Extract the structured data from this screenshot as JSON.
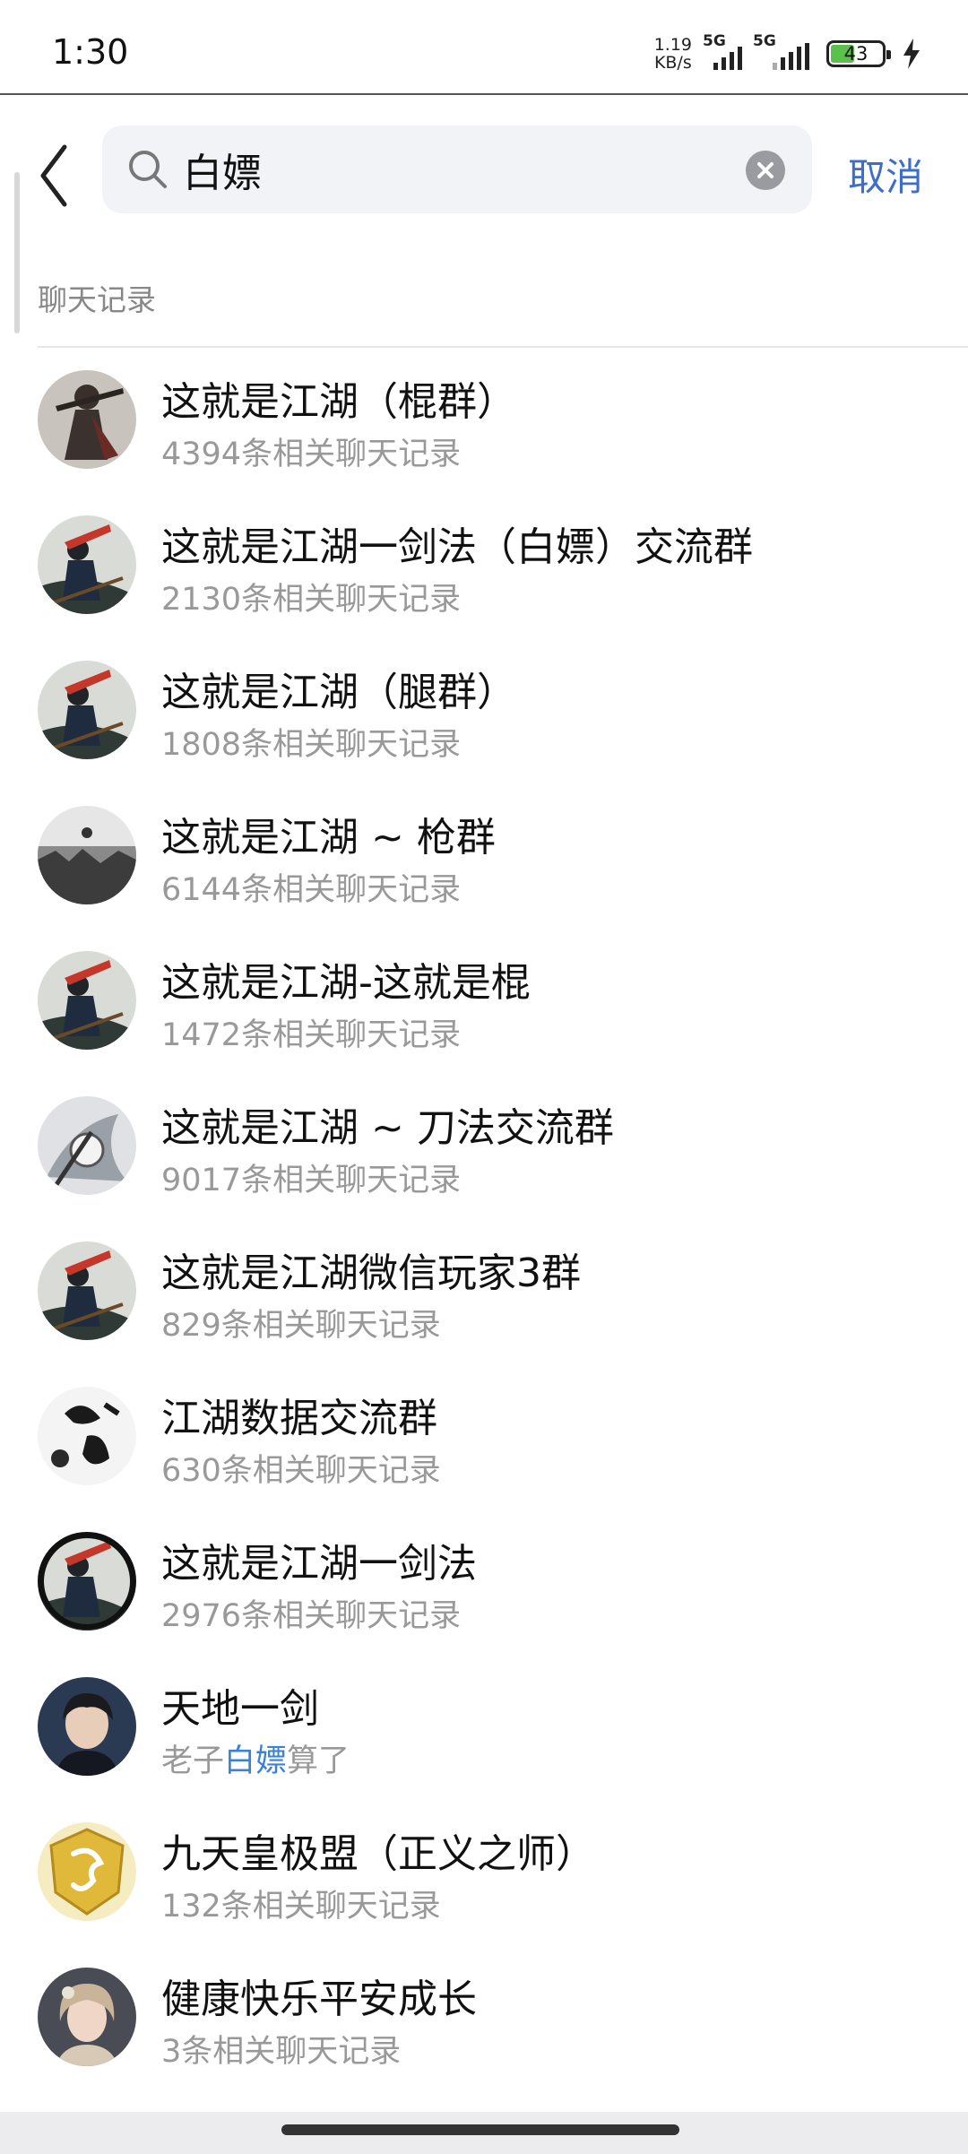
{
  "status_bar": {
    "time": "1:30",
    "net_speed_value": "1.19",
    "net_speed_unit": "KB/s",
    "signal_1_label": "5G",
    "signal_2_label": "5G",
    "battery_level": "43",
    "battery_color": "#5cc14a"
  },
  "search": {
    "query": "白嫖",
    "cancel_label": "取消",
    "back_icon": "chevron-left-icon",
    "search_icon": "magnifier-icon",
    "clear_icon": "clear-circle-icon"
  },
  "section": {
    "title": "聊天记录"
  },
  "accent_color": "#3d6ec9",
  "highlight_color": "#3b82d6",
  "results": [
    {
      "title": "这就是江湖（棍群）",
      "sub_before": "4394条相关聊天记录",
      "avatar": "swordsman-dark"
    },
    {
      "title": "这就是江湖一剑法（白嫖）交流群",
      "sub_before": "2130条相关聊天记录",
      "avatar": "swordsman-red"
    },
    {
      "title": "这就是江湖（腿群）",
      "sub_before": "1808条相关聊天记录",
      "avatar": "swordsman-red"
    },
    {
      "title": "这就是江湖 ~ 枪群",
      "sub_before": "6144条相关聊天记录",
      "avatar": "battlefield"
    },
    {
      "title": "这就是江湖-这就是棍",
      "sub_before": "1472条相关聊天记录",
      "avatar": "swordsman-red"
    },
    {
      "title": "这就是江湖 ~ 刀法交流群",
      "sub_before": "9017条相关聊天记录",
      "avatar": "ink-warrior"
    },
    {
      "title": "这就是江湖微信玩家3群",
      "sub_before": "829条相关聊天记录",
      "avatar": "swordsman-red"
    },
    {
      "title": "江湖数据交流群",
      "sub_before": "630条相关聊天记录",
      "avatar": "calligraphy"
    },
    {
      "title": "这就是江湖一剑法",
      "sub_before": "2976条相关聊天记录",
      "avatar": "swordsman-ring"
    },
    {
      "title": "天地一剑",
      "sub_before": "老子",
      "sub_match": "白嫖",
      "sub_after": "算了",
      "avatar": "portrait-boy"
    },
    {
      "title": "九天皇极盟（正义之师）",
      "sub_before": "132条相关聊天记录",
      "avatar": "gold-dragon"
    },
    {
      "title": "健康快乐平安成长",
      "sub_before": "3条相关聊天记录",
      "avatar": "portrait-girl"
    }
  ]
}
